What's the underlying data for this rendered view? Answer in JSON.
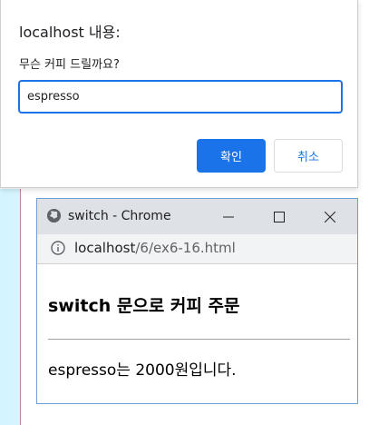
{
  "dialog": {
    "title": "localhost 내용:",
    "message": "무슨 커피 드릴까요?",
    "input_value": "espresso",
    "ok_label": "확인",
    "cancel_label": "취소"
  },
  "window": {
    "title": "switch - Chrome",
    "url_host": "localhost",
    "url_path": "/6/ex6-16.html",
    "heading": "switch 문으로 커피 주문",
    "result_text": "espresso는 2000원입니다."
  },
  "colors": {
    "accent": "#1a73e8",
    "page_strip": "#d4f4ff",
    "window_border": "#6d9fd6",
    "titlebar_bg": "#dee1e6"
  }
}
